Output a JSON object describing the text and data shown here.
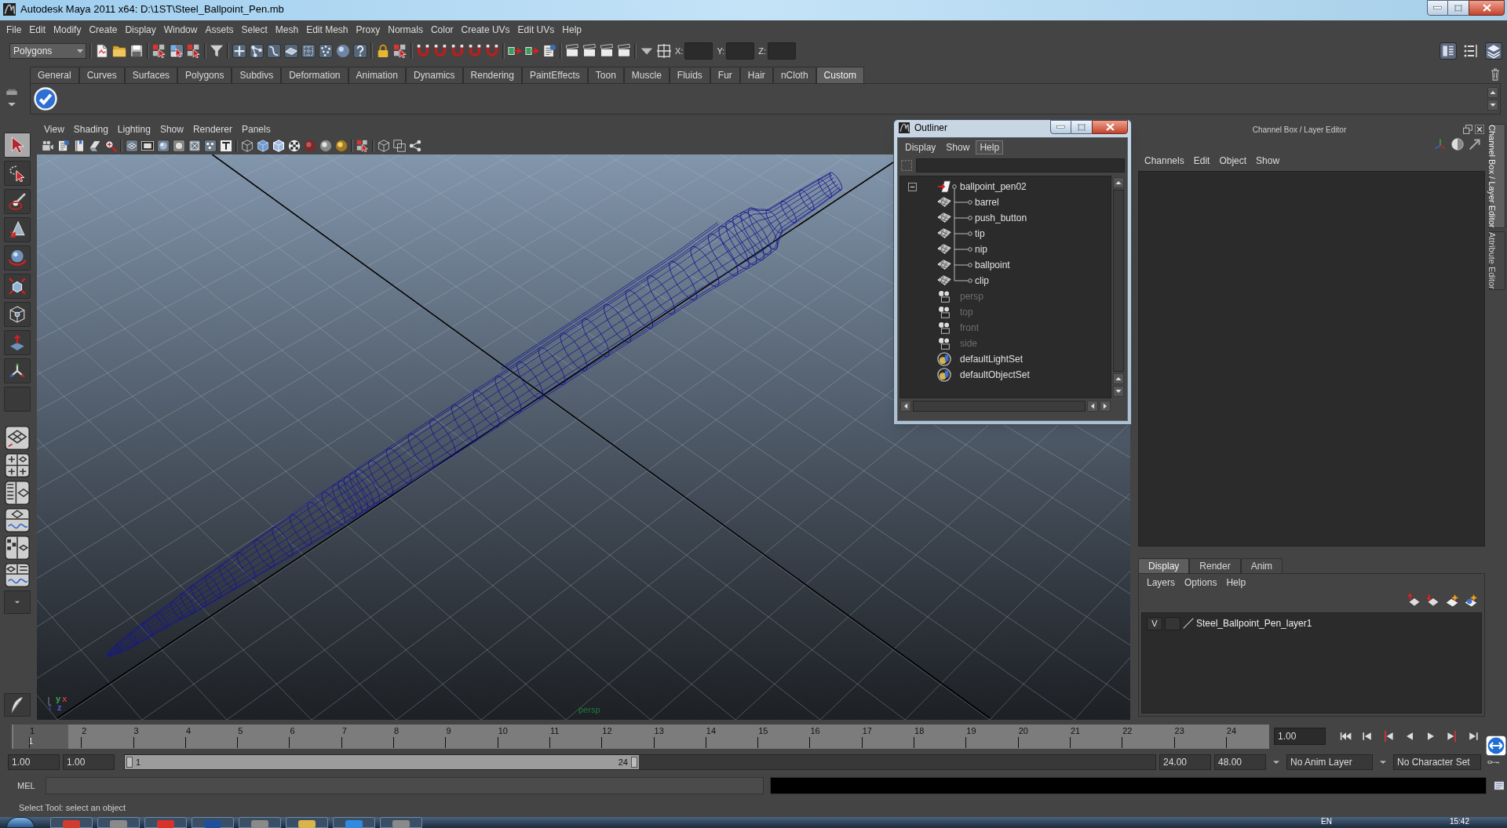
{
  "window": {
    "title": "Autodesk Maya 2011 x64: D:\\1ST\\Steel_Ballpoint_Pen.mb"
  },
  "menu_bar": [
    "File",
    "Edit",
    "Modify",
    "Create",
    "Display",
    "Window",
    "Assets",
    "Select",
    "Mesh",
    "Edit Mesh",
    "Proxy",
    "Normals",
    "Color",
    "Create UVs",
    "Edit UVs",
    "Help"
  ],
  "status_line": {
    "menu_set": "Polygons",
    "fields": [
      {
        "label": "X:"
      },
      {
        "label": "Y:"
      },
      {
        "label": "Z:"
      }
    ]
  },
  "shelf": {
    "tabs": [
      {
        "label": "General",
        "selected": false
      },
      {
        "label": "Curves",
        "selected": false
      },
      {
        "label": "Surfaces",
        "selected": false
      },
      {
        "label": "Polygons",
        "selected": false
      },
      {
        "label": "Subdivs",
        "selected": false
      },
      {
        "label": "Deformation",
        "selected": false
      },
      {
        "label": "Animation",
        "selected": false
      },
      {
        "label": "Dynamics",
        "selected": false
      },
      {
        "label": "Rendering",
        "selected": false
      },
      {
        "label": "PaintEffects",
        "selected": false
      },
      {
        "label": "Toon",
        "selected": false
      },
      {
        "label": "Muscle",
        "selected": false
      },
      {
        "label": "Fluids",
        "selected": false
      },
      {
        "label": "Fur",
        "selected": false
      },
      {
        "label": "Hair",
        "selected": false
      },
      {
        "label": "nCloth",
        "selected": false
      },
      {
        "label": "Custom",
        "selected": true
      }
    ]
  },
  "tools": [
    {
      "selected": true
    },
    {
      "selected": false
    },
    {
      "selected": false
    },
    {
      "selected": false
    },
    {
      "selected": false
    },
    {
      "selected": false
    },
    {
      "selected": false
    },
    {
      "selected": false
    },
    {
      "selected": false
    },
    {
      "selected": false
    }
  ],
  "viewport": {
    "menu": [
      "View",
      "Shading",
      "Lighting",
      "Show",
      "Renderer",
      "Panels"
    ],
    "camera": "persp",
    "axes": [
      {
        "label": "y",
        "color": "#3faa4f"
      },
      {
        "label": "x",
        "color": "#c93a3a"
      },
      {
        "label": "z",
        "color": "#4a64d8"
      }
    ]
  },
  "outliner": {
    "title": "Outliner",
    "menu": [
      {
        "label": "Display",
        "highlighted": false
      },
      {
        "label": "Show",
        "highlighted": false
      },
      {
        "label": "Help",
        "highlighted": true
      }
    ],
    "items": [
      {
        "kind": "group",
        "label": "ballpoint_pen02",
        "expanded": true,
        "dimmed": false,
        "children": [
          {
            "kind": "mesh",
            "label": "barrel",
            "dimmed": false
          },
          {
            "kind": "mesh",
            "label": "push_button",
            "dimmed": false
          },
          {
            "kind": "mesh",
            "label": "tip",
            "dimmed": false
          },
          {
            "kind": "mesh",
            "label": "nip",
            "dimmed": false
          },
          {
            "kind": "mesh",
            "label": "ballpoint",
            "dimmed": false
          },
          {
            "kind": "mesh",
            "label": "clip",
            "dimmed": false
          }
        ]
      },
      {
        "kind": "camera",
        "label": "persp",
        "dimmed": true
      },
      {
        "kind": "camera",
        "label": "top",
        "dimmed": true
      },
      {
        "kind": "camera",
        "label": "front",
        "dimmed": true
      },
      {
        "kind": "camera",
        "label": "side",
        "dimmed": true
      },
      {
        "kind": "set",
        "label": "defaultLightSet",
        "dimmed": false
      },
      {
        "kind": "set",
        "label": "defaultObjectSet",
        "dimmed": false
      }
    ]
  },
  "channel_box": {
    "title": "Channel Box / Layer Editor",
    "menu": [
      "Channels",
      "Edit",
      "Object",
      "Show"
    ]
  },
  "layer_editor": {
    "tabs": [
      {
        "label": "Display",
        "selected": true
      },
      {
        "label": "Render",
        "selected": false
      },
      {
        "label": "Anim",
        "selected": false
      }
    ],
    "menu": [
      "Layers",
      "Options",
      "Help"
    ],
    "layers": [
      {
        "visibility": "V",
        "name": "Steel_Ballpoint_Pen_layer1"
      }
    ]
  },
  "side_tabs": [
    {
      "label": "Channel Box / Layer Editor",
      "selected": true
    },
    {
      "label": "Attribute Editor",
      "selected": false
    }
  ],
  "time_slider": {
    "ticks": [
      "1",
      "2",
      "3",
      "4",
      "5",
      "6",
      "7",
      "8",
      "9",
      "10",
      "11",
      "12",
      "13",
      "14",
      "15",
      "16",
      "17",
      "18",
      "19",
      "20",
      "21",
      "22",
      "23",
      "24"
    ],
    "playhead": {
      "label": "1",
      "level": 0
    },
    "current_time": "1.00"
  },
  "range_slider": {
    "start_time": "1.00",
    "playback_start": "1.00",
    "range_start": "1",
    "range_end": "24",
    "playback_end": "24.00",
    "end_time": "48.00",
    "anim_layer": "No Anim Layer",
    "character_set": "No Character Set"
  },
  "command_line": {
    "language": "MEL"
  },
  "help_line": "Select Tool: select an object",
  "taskbar": {
    "language": "EN",
    "clock": "15:42"
  }
}
